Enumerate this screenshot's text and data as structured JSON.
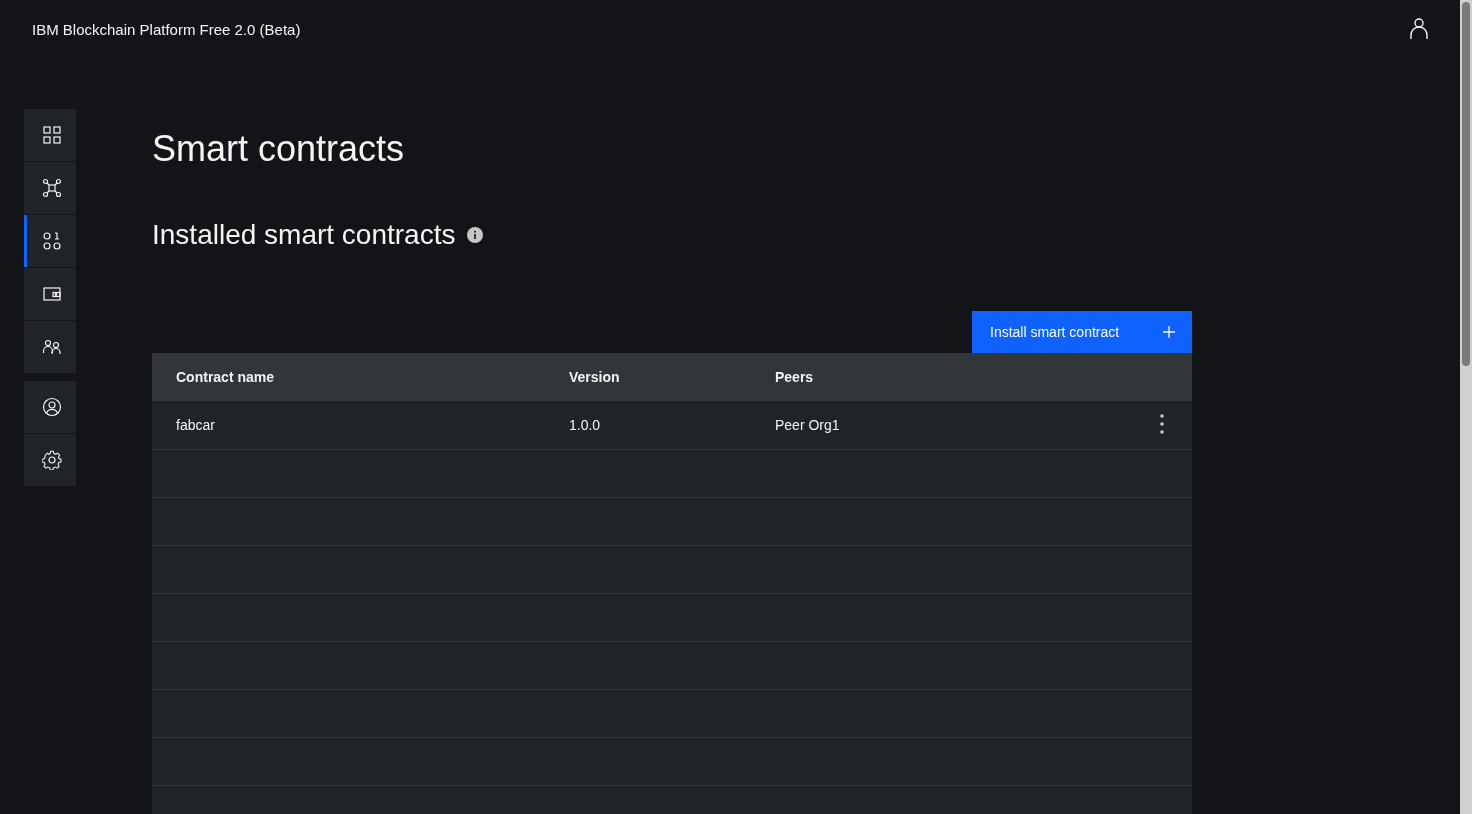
{
  "header": {
    "title": "IBM Blockchain Platform Free 2.0 (Beta)"
  },
  "sidebar": {
    "items": [
      {
        "selected": false
      },
      {
        "selected": false
      },
      {
        "selected": true
      },
      {
        "selected": false
      },
      {
        "selected": false
      },
      {
        "selected": false
      },
      {
        "selected": false
      }
    ]
  },
  "page": {
    "title": "Smart contracts",
    "section_title": "Installed smart contracts"
  },
  "install_button": {
    "label": "Install smart contract"
  },
  "table": {
    "columns": [
      "Contract name",
      "Version",
      "Peers"
    ],
    "rows": [
      {
        "cells": [
          "fabcar",
          "1.0.0",
          "Peer Org1"
        ]
      }
    ]
  }
}
